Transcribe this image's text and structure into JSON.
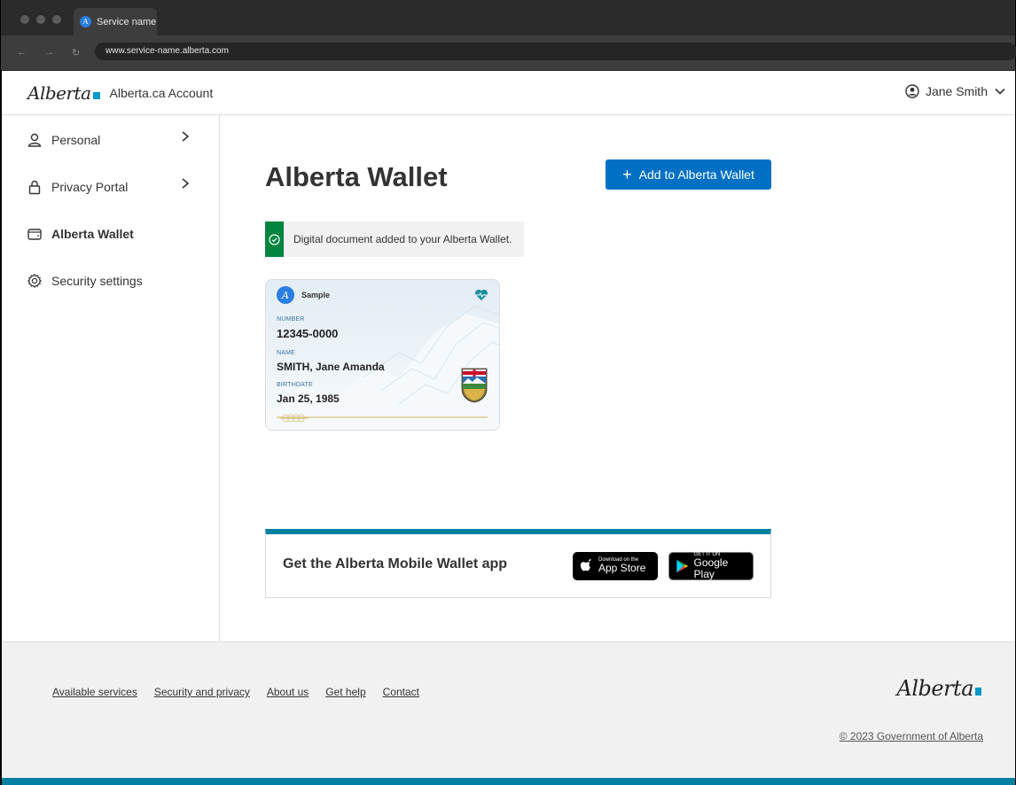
{
  "browser": {
    "tab_title": "Service name",
    "url": "www.service-name.alberta.com"
  },
  "header": {
    "logo_text": "Alberta",
    "title": "Alberta.ca Account",
    "user_name": "Jane Smith"
  },
  "sidebar": {
    "items": [
      {
        "label": "Personal",
        "icon": "person-icon",
        "has_chevron": true
      },
      {
        "label": "Privacy Portal",
        "icon": "lock-icon",
        "has_chevron": true
      },
      {
        "label": "Alberta Wallet",
        "icon": "wallet-icon",
        "active": true
      },
      {
        "label": "Security settings",
        "icon": "gear-icon"
      }
    ]
  },
  "main": {
    "page_title": "Alberta Wallet",
    "add_button_label": "Add to Alberta Wallet",
    "callout_text": "Digital document added to your Alberta Wallet."
  },
  "card": {
    "badge": "Sample",
    "number_label": "NUMBER",
    "number": "12345-0000",
    "name_label": "NAME",
    "name": "SMITH, Jane Amanda",
    "birthdate_label": "BIRTHDATE",
    "birthdate": "Jan 25, 1985"
  },
  "app_banner": {
    "text": "Get the Alberta Mobile Wallet app",
    "appstore_small": "Download on the",
    "appstore_large": "App Store",
    "google_small": "GET IT ON",
    "google_large": "Google Play"
  },
  "footer": {
    "links": [
      "Available services",
      "Security and privacy",
      "About us",
      "Get help",
      "Contact"
    ],
    "logo_text": "Alberta",
    "copyright": "© 2023 Government of Alberta"
  },
  "colors": {
    "primary": "#0070c4",
    "success": "#00853f",
    "teal": "#0081a1"
  }
}
